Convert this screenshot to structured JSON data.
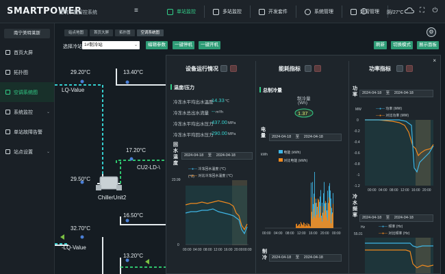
{
  "app": {
    "logo": "SMARTPOWER",
    "subtitle": "建筑节能智控系统",
    "menu_glyph": "≡"
  },
  "nav": [
    {
      "label": "单站监控",
      "active": true
    },
    {
      "label": "多站监控",
      "active": false
    },
    {
      "label": "开发套件",
      "active": false
    },
    {
      "label": "系统管理",
      "active": false
    },
    {
      "label": "运营管理",
      "active": false
    }
  ],
  "header": {
    "weather": "阴/27°C",
    "info": "i"
  },
  "sidebar": {
    "station": "南宁美特莱斯",
    "items": [
      {
        "label": "首页大屏",
        "active": false,
        "has_children": false
      },
      {
        "label": "拓扑图",
        "active": false,
        "has_children": false
      },
      {
        "label": "空调系统图",
        "active": true,
        "has_children": false
      },
      {
        "label": "系统监控",
        "active": false,
        "has_children": true
      },
      {
        "label": "单站故障告警",
        "active": false,
        "has_children": false
      },
      {
        "label": "站点设置",
        "active": false,
        "has_children": true
      }
    ]
  },
  "tabs": [
    {
      "label": "站点地图",
      "active": false
    },
    {
      "label": "首页大屏",
      "active": false
    },
    {
      "label": "拓扑图",
      "active": false
    },
    {
      "label": "空调系统图",
      "active": true
    }
  ],
  "toolbar": {
    "select_label": "选择冷站:",
    "select_value": "1#制冷站",
    "btn_edit": "编辑参数",
    "btn_stop": "一键停机",
    "btn_start": "一键开机",
    "btn_refresh": "刷新",
    "btn_mode": "切换模式",
    "btn_board": "展示面板"
  },
  "schematic": {
    "t1": "29.20°C",
    "t2": "13.40°C",
    "t3": "17.20°C",
    "t4": "29.50°C",
    "t5": "16.50°C",
    "t6": "32.70°C",
    "t7": "13.20°C",
    "lq1": "LQ-Value",
    "lq2": "-LQ-Value",
    "cu": "CU2-LD-\\",
    "chiller": "ChillerUnit2"
  },
  "panel": {
    "close": "×",
    "col1_title": "设备运行情况",
    "col2_title": "能耗指标",
    "col3_title": "功率指标",
    "temp_section": "温度/压力",
    "kv": [
      {
        "label": "冷冻水平均出水温度",
        "value": "14.33",
        "unit": "℃"
      },
      {
        "label": "冷冻水总出水流量",
        "value": "--",
        "unit": "m³/h"
      },
      {
        "label": "冷冻水平均出水压力",
        "value": "437.00",
        "unit": "MPa"
      },
      {
        "label": "冷冻水平均回水压力",
        "value": "290.00",
        "unit": "MPa"
      }
    ],
    "cool_section": "总制冷量",
    "cool_label": "制冷量",
    "cool_unit": "(Wh)",
    "cool_value": "1.37",
    "range_sep": "至",
    "date": "2024-04-18",
    "water_temp_title": "回水温度",
    "power_title_a": "电量",
    "cool_b_title": "制冷",
    "power_rate_title": "功率",
    "freq_title": "冷水频率"
  },
  "chart_temp": {
    "type": "line",
    "ylabel": "(℃)",
    "yticks": [
      "23.99",
      "0"
    ],
    "xticks": [
      "00:00",
      "04:00",
      "08:00",
      "12:00",
      "16:00",
      "20:00",
      "00:00"
    ],
    "series": [
      {
        "name": "冷冻回水温度 (℃)",
        "color": "#3fb6e6"
      },
      {
        "name": "对比冷冻回水温度 (℃)",
        "color": "#f28a1e"
      }
    ]
  },
  "chart_energy": {
    "type": "bar",
    "ylabel": "kWh",
    "xticks": [
      "00:00",
      "04:00",
      "08:00",
      "12:00",
      "16:00",
      "20:00",
      "00:00"
    ],
    "series": [
      {
        "name": "电能 (kWh)",
        "color": "#3fb6e6"
      },
      {
        "name": "对比电能 (kWh)",
        "color": "#f28a1e"
      }
    ]
  },
  "chart_power": {
    "type": "line",
    "ylabel": "MW",
    "yticks": [
      "0",
      "-0.2",
      "-0.4",
      "-0.6",
      "-0.8",
      "-1",
      "-1.2"
    ],
    "xticks": [
      "00:00",
      "04:00",
      "08:00",
      "12:00",
      "16:00",
      "20:00"
    ],
    "series": [
      {
        "name": "功率 (MW)",
        "color": "#3fb6e6"
      },
      {
        "name": "对比功率 (MW)",
        "color": "#f28a1e"
      }
    ]
  },
  "chart_freq": {
    "type": "line",
    "ylabel": "Hz",
    "yticks": [
      "55.01"
    ],
    "series": [
      {
        "name": "频率 (Hz)",
        "color": "#3fb6e6"
      },
      {
        "name": "对比频率 (Hz)",
        "color": "#f28a1e"
      }
    ]
  }
}
